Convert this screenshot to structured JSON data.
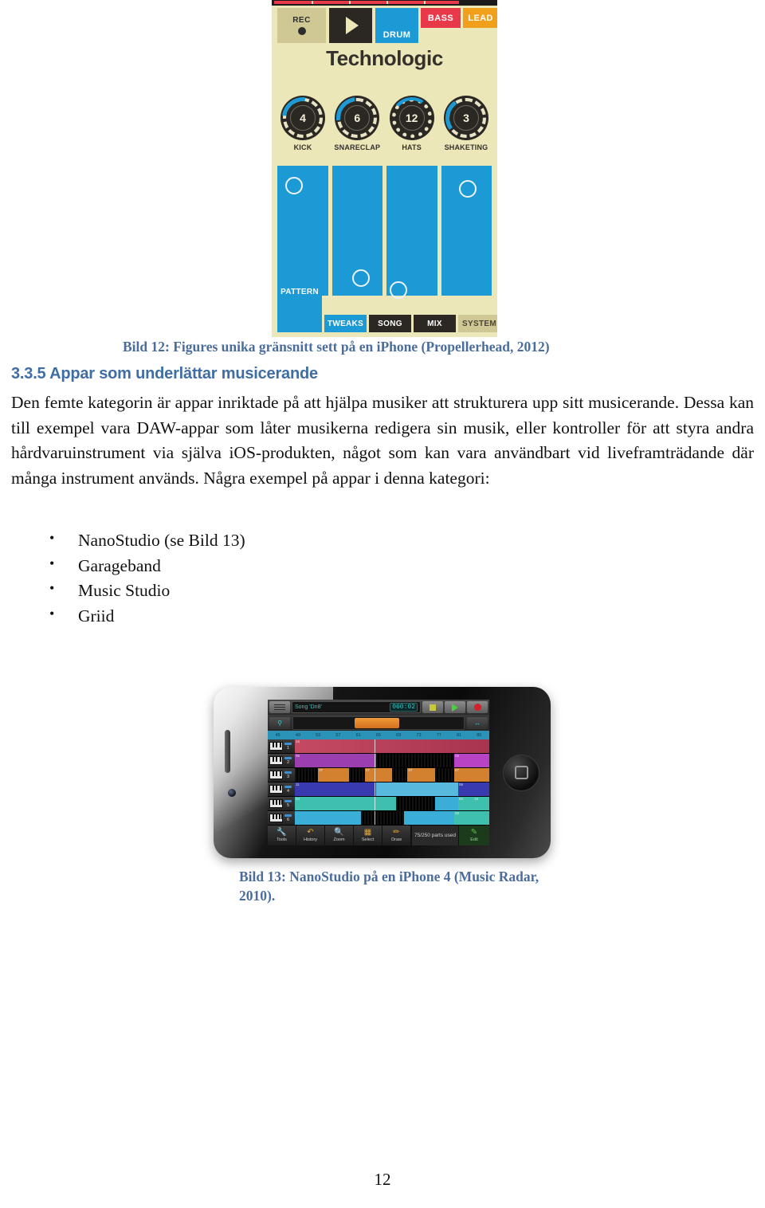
{
  "page": {
    "number": "12"
  },
  "figure12": {
    "app": {
      "rec_label": "REC",
      "play_label": "play-triangle",
      "instrument_tabs": [
        {
          "label": "DRUM",
          "color": "#1b9ad6"
        },
        {
          "label": "BASS",
          "color": "#e8394a"
        },
        {
          "label": "LEAD",
          "color": "#f1a01c"
        }
      ],
      "pattern_title": "Technologic",
      "knobs": [
        {
          "name": "KICK",
          "value": "4"
        },
        {
          "name": "SNARECLAP",
          "value": "6"
        },
        {
          "name": "HATS",
          "value": "12"
        },
        {
          "name": "SHAKETING",
          "value": "3"
        }
      ],
      "bottom_tabs": [
        {
          "label": "PATTERN",
          "active": true
        },
        {
          "label": "TWEAKS",
          "active": true
        },
        {
          "label": "SONG",
          "active": false
        },
        {
          "label": "MIX",
          "active": false
        },
        {
          "label": "SYSTEM",
          "active": false
        }
      ]
    },
    "caption": "Bild 12: Figures unika gränsnitt sett på en iPhone (Propellerhead, 2012)"
  },
  "section": {
    "heading": "3.3.5 Appar som underlättar musicerande",
    "paragraph": "Den femte kategorin är appar inriktade på att hjälpa musiker att strukturera upp sitt musicerande. Dessa kan till exempel vara DAW-appar som låter musikerna redigera sin musik, eller kontroller för att styra andra hårdvaruinstrument via själva iOS-produkten, något som kan vara användbart vid liveframträdande där många instrument används. Några exempel på appar i denna kategori:",
    "bullets": [
      "NanoStudio (se Bild 13)",
      "Garageband",
      "Music Studio",
      "Griid"
    ]
  },
  "figure13": {
    "device": "iPhone 4",
    "app": {
      "menu_icon": "hamburger-icon",
      "song_name": "Song 'Dn8'",
      "timecode": "060:02",
      "transport": [
        {
          "name": "stop-button",
          "glyph": "stop-square"
        },
        {
          "name": "play-button",
          "glyph": "play-triangle"
        },
        {
          "name": "record-button",
          "glyph": "record-dot"
        }
      ],
      "overview_left_icon": "zoom-move-icon",
      "overview_right_icon": "pan-arrows-icon",
      "ruler_marks": [
        "45",
        "49",
        "53",
        "57",
        "61",
        "65",
        "69",
        "73",
        "77",
        "81",
        "85"
      ],
      "tracks": [
        {
          "number": "1",
          "icon": "keyboard-icon",
          "color": "#b83b55",
          "clips": [
            "16",
            "16",
            "16"
          ]
        },
        {
          "number": "2",
          "icon": "keyboard-icon",
          "color": "#9b3fb0",
          "clips": [
            "06",
            "06",
            "06",
            "06",
            "02"
          ]
        },
        {
          "number": "3",
          "icon": "keyboard-icon",
          "color": "#d3802f",
          "clips": [
            "07",
            "07",
            "07",
            "07",
            "07"
          ]
        },
        {
          "number": "4",
          "icon": "keyboard-icon",
          "color": "#3a3ab0",
          "clips": [
            "11",
            "06"
          ]
        },
        {
          "number": "5",
          "icon": "pad-grid-icon",
          "color": "#3fbfae",
          "clips": [
            "04",
            "04",
            "04"
          ]
        },
        {
          "number": "6",
          "icon": "pad-grid-icon",
          "color": "#3aaed6",
          "clips": [
            "02"
          ]
        }
      ],
      "tools": [
        {
          "label": "Tools",
          "icon": "wrench-icon"
        },
        {
          "label": "History",
          "icon": "undo-arrow-icon"
        },
        {
          "label": "Zoom",
          "icon": "magnifier-icon"
        },
        {
          "label": "Select",
          "icon": "marquee-icon"
        },
        {
          "label": "Draw",
          "icon": "pencil-icon"
        }
      ],
      "status": "75/250 parts used",
      "edit_label": "Edit",
      "edit_icon": "edit-icon"
    },
    "caption": "Bild 13: NanoStudio på en iPhone 4 (Music Radar, 2010)."
  },
  "colors": {
    "caption_blue": "#4a6d9e",
    "heading_blue": "#3f6ea5",
    "figure_bg": "#ece7b8",
    "figure_accent_blue": "#1b9ad6",
    "figure_red": "#e8394a",
    "figure_orange": "#f1a01c"
  }
}
